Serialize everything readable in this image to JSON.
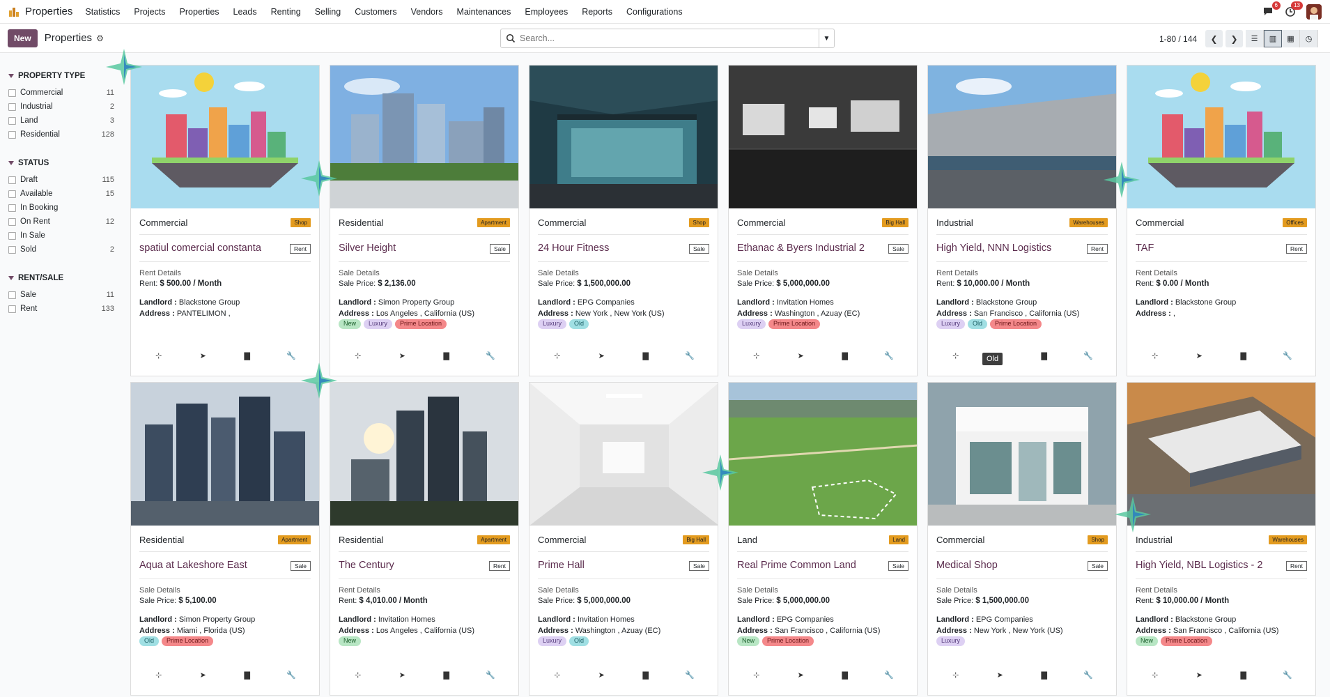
{
  "app": {
    "name": "Properties",
    "menu": [
      "Statistics",
      "Projects",
      "Properties",
      "Leads",
      "Renting",
      "Selling",
      "Customers",
      "Vendors",
      "Maintenances",
      "Employees",
      "Reports",
      "Configurations"
    ],
    "chat_badge": "6",
    "activity_badge": "13"
  },
  "control": {
    "new_label": "New",
    "breadcrumb": "Properties",
    "search_placeholder": "Search...",
    "pager": "1-80 / 144"
  },
  "sidebar": {
    "groups": [
      {
        "title": "PROPERTY TYPE",
        "items": [
          [
            "Commercial",
            "11"
          ],
          [
            "Industrial",
            "2"
          ],
          [
            "Land",
            "3"
          ],
          [
            "Residential",
            "128"
          ]
        ]
      },
      {
        "title": "STATUS",
        "items": [
          [
            "Draft",
            "115"
          ],
          [
            "Available",
            "15"
          ],
          [
            "In Booking",
            ""
          ],
          [
            "On Rent",
            "12"
          ],
          [
            "In Sale",
            ""
          ],
          [
            "Sold",
            "2"
          ]
        ]
      },
      {
        "title": "RENT/SALE",
        "items": [
          [
            "Sale",
            "11"
          ],
          [
            "Rent",
            "133"
          ]
        ]
      }
    ]
  },
  "tooltip": "Old",
  "cards": [
    {
      "type": "Commercial",
      "sub": "Shop",
      "title": "spatiul comercial constanta",
      "mode": "Rent",
      "det_h": "Rent Details",
      "det_l": "Rent:",
      "det_v": "$ 500.00 / Month",
      "landlord": "Blackstone Group",
      "address": "PANTELIMON ,",
      "tags": [],
      "img": "city"
    },
    {
      "type": "Residential",
      "sub": "Apartment",
      "title": "Silver Height",
      "mode": "Sale",
      "det_h": "Sale Details",
      "det_l": "Sale Price:",
      "det_v": "$ 2,136.00",
      "landlord": "Simon Property Group",
      "address": "Los Angeles , California (US)",
      "tags": [
        "New",
        "Luxury",
        "Prime Location"
      ],
      "img": "towers"
    },
    {
      "type": "Commercial",
      "sub": "Shop",
      "title": "24 Hour Fitness",
      "mode": "Sale",
      "det_h": "Sale Details",
      "det_l": "Sale Price:",
      "det_v": "$ 1,500,000.00",
      "landlord": "EPG Companies",
      "address": "New York , New York (US)",
      "tags": [
        "Luxury",
        "Old"
      ],
      "img": "glass"
    },
    {
      "type": "Commercial",
      "sub": "Big Hall",
      "title": "Ethanac & Byers Industrial 2",
      "mode": "Sale",
      "det_h": "Sale Details",
      "det_l": "Sale Price:",
      "det_v": "$ 5,000,000.00",
      "landlord": "Invitation Homes",
      "address": "Washington , Azuay (EC)",
      "tags": [
        "Luxury",
        "Prime Location"
      ],
      "img": "hall"
    },
    {
      "type": "Industrial",
      "sub": "Warehouses",
      "title": "High Yield, NNN Logistics",
      "mode": "Rent",
      "det_h": "Rent Details",
      "det_l": "Rent:",
      "det_v": "$ 10,000.00 / Month",
      "landlord": "Blackstone Group",
      "address": "San Francisco , California (US)",
      "tags": [
        "Luxury",
        "Old",
        "Prime Location"
      ],
      "img": "warehouse"
    },
    {
      "type": "Commercial",
      "sub": "Offices",
      "title": "TAF",
      "mode": "Rent",
      "det_h": "Rent Details",
      "det_l": "Rent:",
      "det_v": "$ 0.00 / Month",
      "landlord": "Blackstone Group",
      "address": ",",
      "tags": [],
      "img": "city"
    },
    {
      "type": "Residential",
      "sub": "Apartment",
      "title": "Aqua at Lakeshore East",
      "mode": "Sale",
      "det_h": "Sale Details",
      "det_l": "Sale Price:",
      "det_v": "$ 5,100.00",
      "landlord": "Simon Property Group",
      "address": "Miami , Florida (US)",
      "tags": [
        "Old",
        "Prime Location"
      ],
      "img": "skyline"
    },
    {
      "type": "Residential",
      "sub": "Apartment",
      "title": "The Century",
      "mode": "Rent",
      "det_h": "Rent Details",
      "det_l": "Rent:",
      "det_v": "$ 4,010.00 / Month",
      "landlord": "Invitation Homes",
      "address": "Los Angeles , California (US)",
      "tags": [
        "New"
      ],
      "img": "towers2"
    },
    {
      "type": "Commercial",
      "sub": "Big Hall",
      "title": "Prime Hall",
      "mode": "Sale",
      "det_h": "Sale Details",
      "det_l": "Sale Price:",
      "det_v": "$ 5,000,000.00",
      "landlord": "Invitation Homes",
      "address": "Washington , Azuay (EC)",
      "tags": [
        "Luxury",
        "Old"
      ],
      "img": "white"
    },
    {
      "type": "Land",
      "sub": "Land",
      "title": "Real Prime Common Land",
      "mode": "Sale",
      "det_h": "Sale Details",
      "det_l": "Sale Price:",
      "det_v": "$ 5,000,000.00",
      "landlord": "EPG Companies",
      "address": "San Francisco , California (US)",
      "tags": [
        "New",
        "Prime Location"
      ],
      "img": "land"
    },
    {
      "type": "Commercial",
      "sub": "Shop",
      "title": "Medical Shop",
      "mode": "Sale",
      "det_h": "Sale Details",
      "det_l": "Sale Price:",
      "det_v": "$ 1,500,000.00",
      "landlord": "EPG Companies",
      "address": "New York , New York (US)",
      "tags": [
        "Luxury"
      ],
      "img": "shop"
    },
    {
      "type": "Industrial",
      "sub": "Warehouses",
      "title": "High Yield, NBL Logistics - 2",
      "mode": "Rent",
      "det_h": "Rent Details",
      "det_l": "Rent:",
      "det_v": "$ 10,000.00 / Month",
      "landlord": "Blackstone Group",
      "address": "San Francisco , California (US)",
      "tags": [
        "New",
        "Prime Location"
      ],
      "img": "aerial"
    }
  ]
}
